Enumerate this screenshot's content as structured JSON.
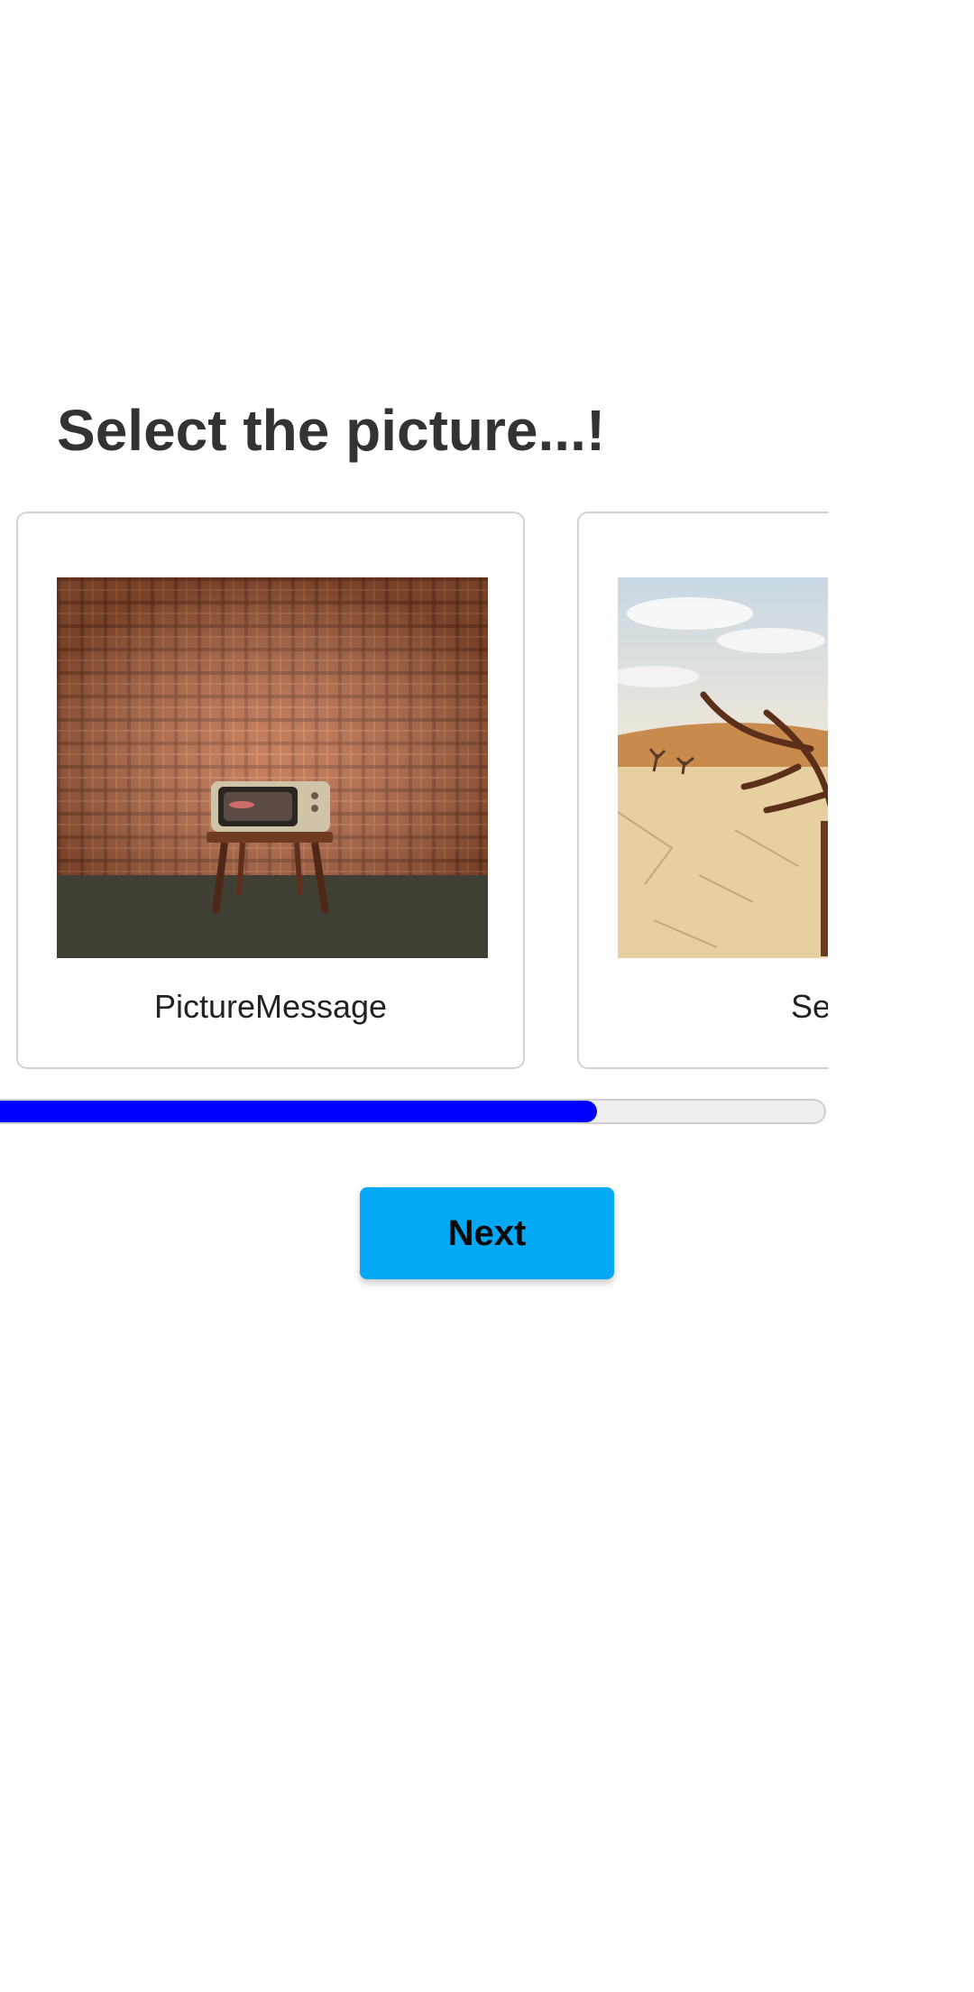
{
  "page": {
    "title": "Select the picture...!"
  },
  "cards": [
    {
      "label": "PictureMessage",
      "image_icon": "retro-tv-on-stool-image"
    },
    {
      "label": "Selec",
      "image_icon": "desert-dead-tree-image"
    }
  ],
  "progress": {
    "value_fraction": 0.73,
    "fill_color": "#0000ff",
    "track_color": "#efefef"
  },
  "actions": {
    "next_label": "Next",
    "next_color": "#03a9f4"
  }
}
